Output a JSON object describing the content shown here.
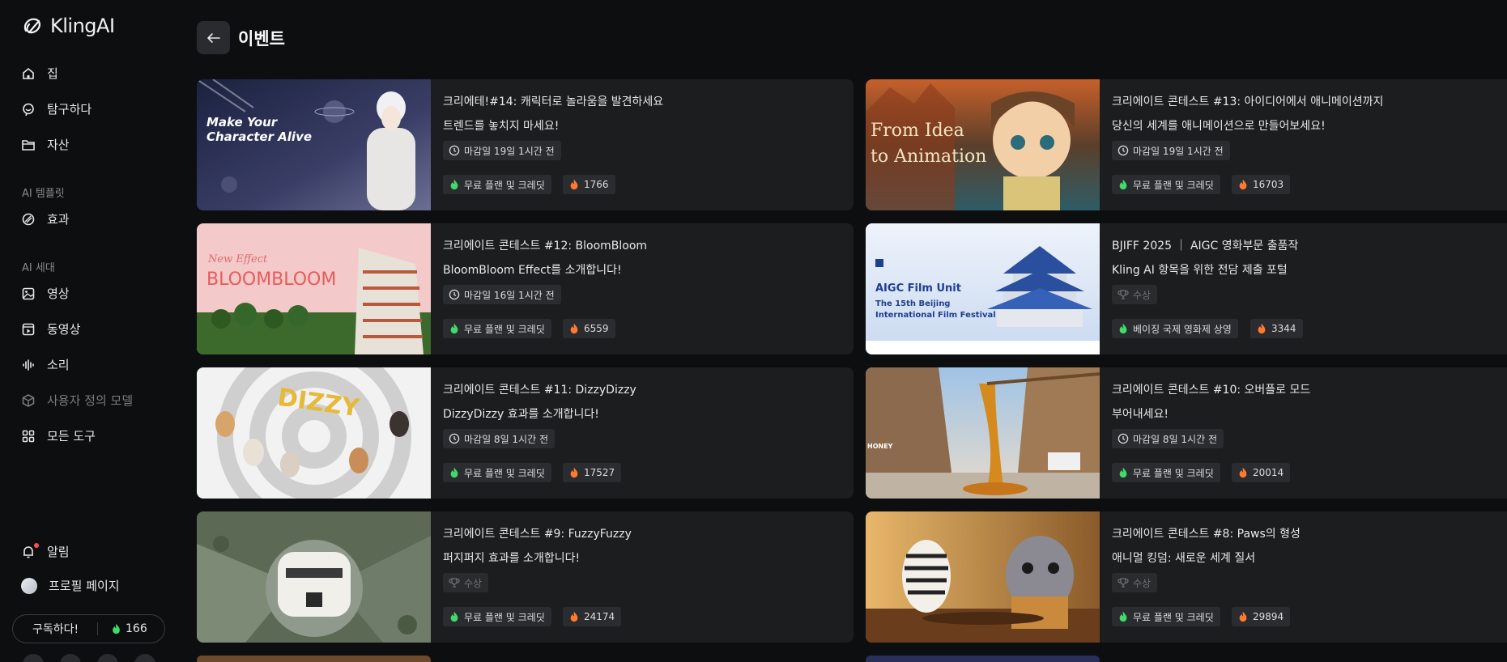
{
  "app": {
    "name": "KlingAI"
  },
  "nav": {
    "home": "집",
    "explore": "탐구하다",
    "assets": "자산",
    "templates_section": "AI 템플릿",
    "effects": "효과",
    "gen_section": "AI 세대",
    "image": "영상",
    "video": "동영상",
    "sound": "소리",
    "custom_model": "사용자 정의 모델",
    "all_tools": "모든 도구",
    "notifications": "알림",
    "profile": "프로필 페이지",
    "subscribe": "구독하다!",
    "credits": "166"
  },
  "header": {
    "title": "이벤트"
  },
  "colors": {
    "accent_green": "#3ddc6b",
    "fire_orange": "#ff7a2f",
    "card_bg": "#1c1d1f"
  },
  "events": [
    {
      "title": "크리에테!#14: 캐릭터로 놀라움을 발견하세요",
      "subtitle": "트렌드를 놓치지 마세요!",
      "badge": "마감일 19일 1시간 전",
      "badge_type": "deadline",
      "tag": "무료 플랜 및 크레딧",
      "count": "1766",
      "thumb_text": [
        "Make Your",
        "Character Alive"
      ]
    },
    {
      "title": "크리에이트 콘테스트 #13: 아이디어에서 애니메이션까지",
      "subtitle": "당신의 세계를 애니메이션으로 만들어보세요!",
      "badge": "마감일 19일 1시간 전",
      "badge_type": "deadline",
      "tag": "무료 플랜 및 크레딧",
      "count": "16703",
      "thumb_text": [
        "From Idea",
        "to Animation"
      ]
    },
    {
      "title": "크리에이트 콘테스트 #12: BloomBloom",
      "subtitle": "BloomBloom Effect를 소개합니다!",
      "badge": "마감일 16일 1시간 전",
      "badge_type": "deadline",
      "tag": "무료 플랜 및 크레딧",
      "count": "6559",
      "thumb_text": [
        "New Effect",
        "BLOOMBLOOM"
      ]
    },
    {
      "title": "BJIFF 2025 ｜ AIGC 영화부문 출품작",
      "subtitle": "Kling AI 항목을 위한 전담 제출 포털",
      "badge": "수상",
      "badge_type": "award",
      "tag": "베이징 국제 영화제 상영",
      "count": "3344",
      "thumb_text": [
        "AIGC Film Unit",
        "The 15th Beijing",
        "International Film Festival"
      ]
    },
    {
      "title": "크리에이트 콘테스트 #11: DizzyDizzy",
      "subtitle": "DizzyDizzy 효과를 소개합니다!",
      "badge": "마감일 8일 1시간 전",
      "badge_type": "deadline",
      "tag": "무료 플랜 및 크레딧",
      "count": "17527",
      "thumb_text": [
        "DIZZY"
      ]
    },
    {
      "title": "크리에이트 콘테스트 #10: 오버플로 모드",
      "subtitle": "부어내세요!",
      "badge": "마감일 8일 1시간 전",
      "badge_type": "deadline",
      "tag": "무료 플랜 및 크레딧",
      "count": "20014",
      "thumb_text": [
        "HONEY"
      ]
    },
    {
      "title": "크리에이트 콘테스트 #9: FuzzyFuzzy",
      "subtitle": "퍼지퍼지 효과를 소개합니다!",
      "badge": "수상",
      "badge_type": "award",
      "tag": "무료 플랜 및 크레딧",
      "count": "24174",
      "thumb_text": []
    },
    {
      "title": "크리에이트 콘테스트 #8: Paws의 형성",
      "subtitle": "애니멀 킹덤: 새로운 세계 질서",
      "badge": "수상",
      "badge_type": "award",
      "tag": "무료 플랜 및 크레딧",
      "count": "29894",
      "thumb_text": []
    }
  ]
}
